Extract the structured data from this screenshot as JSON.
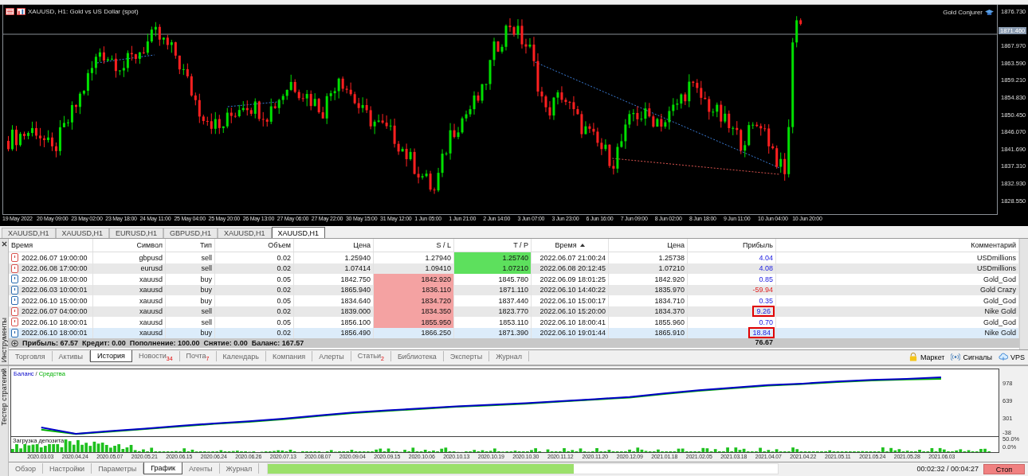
{
  "chart": {
    "title": "XAUUSD, H1:  Gold vs US Dollar (spot)",
    "expert": "Gold Conjurer",
    "current_price": "1871.460",
    "price_axis": [
      "1876.730",
      "1867.970",
      "1863.590",
      "1859.210",
      "1854.830",
      "1850.450",
      "1846.070",
      "1841.690",
      "1837.310",
      "1832.930",
      "1828.550"
    ],
    "time_axis": [
      "19 May 2022",
      "20 May 09:00",
      "23 May 02:00",
      "23 May 18:00",
      "24 May 11:00",
      "25 May 04:00",
      "25 May 20:00",
      "26 May 13:00",
      "27 May 06:00",
      "27 May 22:00",
      "30 May 15:00",
      "31 May 12:00",
      "1 Jun 05:00",
      "1 Jun 21:00",
      "2 Jun 14:00",
      "3 Jun 07:00",
      "3 Jun 23:00",
      "6 Jun 16:00",
      "7 Jun 09:00",
      "8 Jun 02:00",
      "8 Jun 18:00",
      "9 Jun 11:00",
      "10 Jun 04:00",
      "10 Jun 20:00"
    ]
  },
  "chart_tabs": [
    {
      "label": "XAUUSD,H1",
      "selected": false
    },
    {
      "label": "XAUUSD,H1",
      "selected": false
    },
    {
      "label": "EURUSD,H1",
      "selected": false
    },
    {
      "label": "GBPUSD,H1",
      "selected": false
    },
    {
      "label": "XAUUSD,H1",
      "selected": false
    },
    {
      "label": "XAUUSD,H1",
      "selected": true
    }
  ],
  "toolbox": {
    "title": "Инструменты",
    "columns": [
      {
        "label": "Время",
        "sorted": false
      },
      {
        "label": "Символ",
        "sorted": false
      },
      {
        "label": "Тип",
        "sorted": false
      },
      {
        "label": "Объем",
        "sorted": false
      },
      {
        "label": "Цена",
        "sorted": false
      },
      {
        "label": "S / L",
        "sorted": false
      },
      {
        "label": "T / P",
        "sorted": false
      },
      {
        "label": "Время",
        "sorted": true
      },
      {
        "label": "Цена",
        "sorted": false
      },
      {
        "label": "Прибыль",
        "sorted": false
      },
      {
        "label": "Комментарий",
        "sorted": false
      }
    ],
    "rows": [
      {
        "kind": "sell",
        "time": "2022.06.07 19:00:00",
        "symbol": "gbpusd",
        "type": "sell",
        "volume": "0.02",
        "price": "1.25940",
        "sl": "1.27940",
        "sl_highlight": false,
        "tp": "1.25740",
        "tp_highlight": true,
        "close_time": "2022.06.07 21:00:24",
        "close_price": "1.25738",
        "profit": "4.04",
        "negative": false,
        "outlined": false,
        "comment": "USDmillions",
        "selected": false
      },
      {
        "kind": "sell",
        "time": "2022.06.08 17:00:00",
        "symbol": "eurusd",
        "type": "sell",
        "volume": "0.02",
        "price": "1.07414",
        "sl": "1.09410",
        "sl_highlight": false,
        "tp": "1.07210",
        "tp_highlight": true,
        "close_time": "2022.06.08 20:12:45",
        "close_price": "1.07210",
        "profit": "4.08",
        "negative": false,
        "outlined": false,
        "comment": "USDmillions",
        "selected": false
      },
      {
        "kind": "buy",
        "time": "2022.06.09 18:00:00",
        "symbol": "xauusd",
        "type": "buy",
        "volume": "0.05",
        "price": "1842.750",
        "sl": "1842.920",
        "sl_highlight": true,
        "tp": "1845.780",
        "tp_highlight": false,
        "close_time": "2022.06.09 18:01:25",
        "close_price": "1842.920",
        "profit": "0.85",
        "negative": false,
        "outlined": false,
        "comment": "Gold_God",
        "selected": false
      },
      {
        "kind": "buy",
        "time": "2022.06.03 10:00:01",
        "symbol": "xauusd",
        "type": "buy",
        "volume": "0.02",
        "price": "1865.940",
        "sl": "1836.110",
        "sl_highlight": true,
        "tp": "1871.110",
        "tp_highlight": false,
        "close_time": "2022.06.10 14:40:22",
        "close_price": "1835.970",
        "profit": "-59.94",
        "negative": true,
        "outlined": false,
        "comment": "Gold Crazy",
        "selected": false
      },
      {
        "kind": "buy",
        "time": "2022.06.10 15:00:00",
        "symbol": "xauusd",
        "type": "buy",
        "volume": "0.05",
        "price": "1834.640",
        "sl": "1834.720",
        "sl_highlight": true,
        "tp": "1837.440",
        "tp_highlight": false,
        "close_time": "2022.06.10 15:00:17",
        "close_price": "1834.710",
        "profit": "0.35",
        "negative": false,
        "outlined": false,
        "comment": "Gold_God",
        "selected": false
      },
      {
        "kind": "sell",
        "time": "2022.06.07 04:00:00",
        "symbol": "xauusd",
        "type": "sell",
        "volume": "0.02",
        "price": "1839.000",
        "sl": "1834.350",
        "sl_highlight": true,
        "tp": "1823.770",
        "tp_highlight": false,
        "close_time": "2022.06.10 15:20:00",
        "close_price": "1834.370",
        "profit": "9.26",
        "negative": false,
        "outlined": true,
        "comment": "Nike Gold",
        "selected": false
      },
      {
        "kind": "sell",
        "time": "2022.06.10 18:00:01",
        "symbol": "xauusd",
        "type": "sell",
        "volume": "0.05",
        "price": "1856.100",
        "sl": "1855.950",
        "sl_highlight": true,
        "tp": "1853.110",
        "tp_highlight": false,
        "close_time": "2022.06.10 18:00:41",
        "close_price": "1855.960",
        "profit": "0.70",
        "negative": false,
        "outlined": false,
        "comment": "Gold_God",
        "selected": false
      },
      {
        "kind": "buy",
        "time": "2022.06.10 18:00:01",
        "symbol": "xauusd",
        "type": "buy",
        "volume": "0.02",
        "price": "1856.490",
        "sl": "1866.250",
        "sl_highlight": false,
        "tp": "1871.390",
        "tp_highlight": false,
        "close_time": "2022.06.10 19:01:44",
        "close_price": "1865.910",
        "profit": "18.84",
        "negative": false,
        "outlined": true,
        "comment": "Nike Gold",
        "selected": true
      }
    ],
    "summary": "Прибыль: 67.57  Кредит: 0.00  Пополнение: 100.00  Снятие: 0.00  Баланс: 167.57",
    "total_profit": "76.67",
    "tabs": [
      {
        "label": "Торговля",
        "selected": false
      },
      {
        "label": "Активы",
        "selected": false
      },
      {
        "label": "История",
        "selected": true
      },
      {
        "label": "Новости",
        "badge": "34",
        "selected": false
      },
      {
        "label": "Почта",
        "badge": "7",
        "selected": false
      },
      {
        "label": "Календарь",
        "selected": false
      },
      {
        "label": "Компания",
        "selected": false
      },
      {
        "label": "Алерты",
        "selected": false
      },
      {
        "label": "Статьи",
        "badge": "2",
        "selected": false
      },
      {
        "label": "Библиотека",
        "selected": false
      },
      {
        "label": "Эксперты",
        "selected": false
      },
      {
        "label": "Журнал",
        "selected": false
      }
    ],
    "services": [
      {
        "kind": "market",
        "label": "Маркет"
      },
      {
        "kind": "signals",
        "label": "Сигналы"
      },
      {
        "kind": "vps",
        "label": "VPS"
      }
    ]
  },
  "tester": {
    "title": "Тестер стратегий",
    "legend_separator": "/",
    "chart_data": {
      "type": "line",
      "categories": [
        "2020.03.03",
        "2020.04.24",
        "2020.05.07",
        "2020.05.21",
        "2020.06.15",
        "2020.06.24",
        "2020.06.26",
        "2020.07.13",
        "2020.08.07",
        "2020.09.04",
        "2020.09.15",
        "2020.10.06",
        "2020.10.13",
        "2020.10.19",
        "2020.10.30",
        "2020.11.12",
        "2020.11.20",
        "2020.12.09",
        "2021.01.18",
        "2021.02.05",
        "2021.03.18",
        "2021.04.07",
        "2021.04.22",
        "2021.05.11",
        "2021.05.24",
        "2021.05.28",
        "2021.06.03"
      ],
      "series": [
        {
          "name": "Баланс",
          "color": "#0000c8",
          "values": [
            130,
            10,
            60,
            110,
            160,
            210,
            250,
            300,
            360,
            420,
            460,
            500,
            540,
            570,
            600,
            640,
            680,
            720,
            790,
            850,
            900,
            950,
            980,
            1020,
            1050,
            1070,
            1100
          ]
        },
        {
          "name": "Средства",
          "color": "#00b000",
          "values": [
            90,
            5,
            50,
            100,
            150,
            200,
            240,
            290,
            350,
            410,
            450,
            490,
            530,
            560,
            590,
            630,
            670,
            710,
            780,
            840,
            890,
            940,
            970,
            1010,
            1040,
            1060,
            1070
          ]
        }
      ],
      "ylim": [
        -38,
        1255
      ],
      "yticks": [
        978,
        639,
        301,
        -38
      ]
    },
    "load_label": "Загрузка депозита",
    "load_axis": [
      "50.0%",
      "0.0%"
    ],
    "tabs": [
      {
        "label": "Обзор",
        "selected": false
      },
      {
        "label": "Настройки",
        "selected": false
      },
      {
        "label": "Параметры",
        "selected": false
      },
      {
        "label": "График",
        "selected": true
      },
      {
        "label": "Агенты",
        "selected": false
      },
      {
        "label": "Журнал",
        "selected": false
      }
    ],
    "progress": {
      "level": 0.6
    },
    "time": "00:02:32 / 00:04:27",
    "stop_button": "Стоп"
  }
}
